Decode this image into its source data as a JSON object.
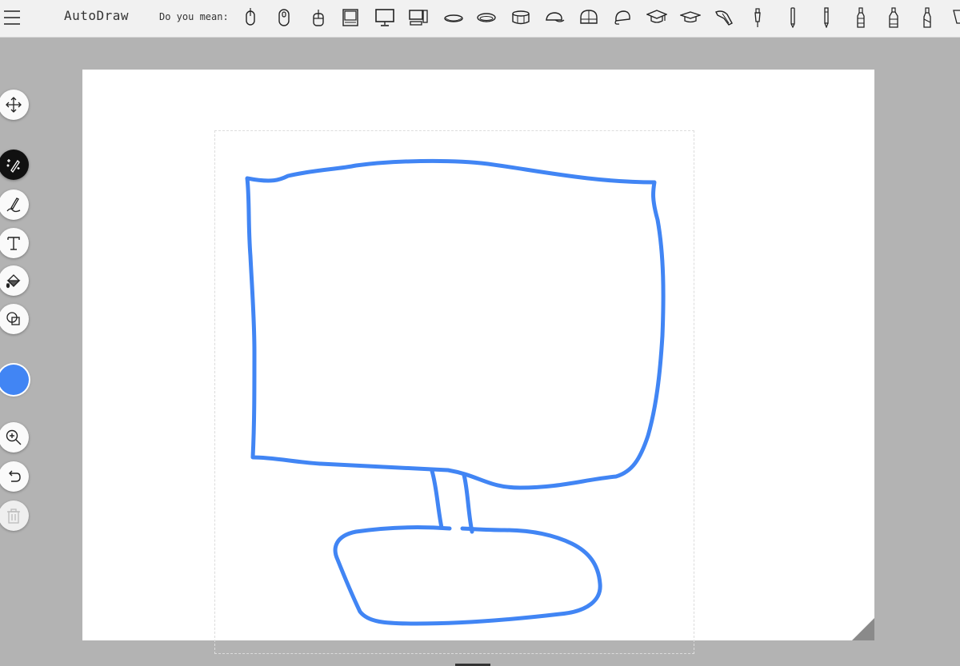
{
  "app": {
    "title": "AutoDraw"
  },
  "suggestions": {
    "label": "Do you mean:",
    "items": [
      "computer-mouse-icon",
      "computer-mouse-icon",
      "computer-mouse-icon",
      "laptop-icon",
      "monitor-icon",
      "desktop-computer-icon",
      "hat-icon",
      "hat-icon",
      "hat-icon",
      "cap-icon",
      "baseball-cap-icon",
      "cap-icon",
      "graduation-cap-icon",
      "graduation-cap-icon",
      "hand-icon",
      "pen-icon",
      "pen-icon",
      "pen-icon",
      "bottle-icon",
      "bottle-icon",
      "bottle-icon",
      "glass-icon"
    ]
  },
  "tools": [
    {
      "name": "move",
      "icon": "move-icon"
    },
    {
      "name": "autodraw",
      "icon": "autodraw-icon",
      "active": true
    },
    {
      "name": "draw",
      "icon": "pencil-icon"
    },
    {
      "name": "type",
      "icon": "text-icon"
    },
    {
      "name": "fill",
      "icon": "fill-bucket-icon"
    },
    {
      "name": "shape",
      "icon": "shape-icon"
    },
    {
      "name": "zoom",
      "icon": "zoom-in-icon"
    },
    {
      "name": "undo",
      "icon": "undo-icon"
    },
    {
      "name": "delete",
      "icon": "trash-icon",
      "disabled": true
    }
  ],
  "colors": {
    "stroke": "#4185f4",
    "active_tool_bg": "#111111",
    "canvas_bg": "#ffffff",
    "workspace_bg": "#b3b3b3"
  }
}
